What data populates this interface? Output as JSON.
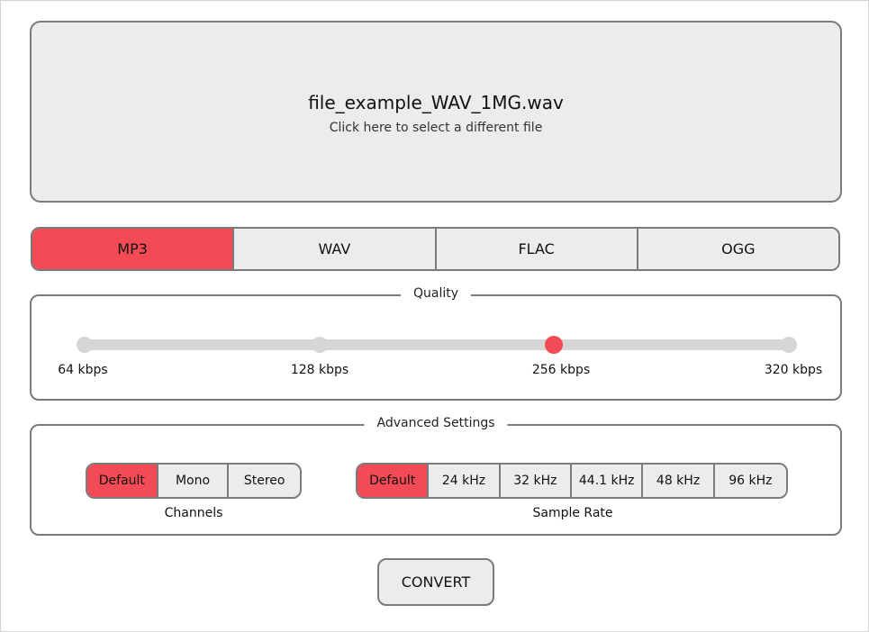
{
  "file": {
    "name": "file_example_WAV_1MG.wav",
    "hint": "Click here to select a different file"
  },
  "formats": {
    "items": [
      "MP3",
      "WAV",
      "FLAC",
      "OGG"
    ],
    "selected": "MP3"
  },
  "quality": {
    "legend": "Quality",
    "stops": [
      "64 kbps",
      "128 kbps",
      "256 kbps",
      "320 kbps"
    ],
    "selected": "256 kbps"
  },
  "advanced": {
    "legend": "Advanced Settings",
    "channels": {
      "caption": "Channels",
      "options": [
        "Default",
        "Mono",
        "Stereo"
      ],
      "selected": "Default"
    },
    "sample_rate": {
      "caption": "Sample Rate",
      "options": [
        "Default",
        "24 kHz",
        "32 kHz",
        "44.1 kHz",
        "48 kHz",
        "96 kHz"
      ],
      "selected": "Default"
    }
  },
  "convert_label": "CONVERT",
  "colors": {
    "accent": "#f24b55",
    "control_bg": "#ececec",
    "border": "#7a7a7a",
    "track": "#d6d6d6"
  }
}
